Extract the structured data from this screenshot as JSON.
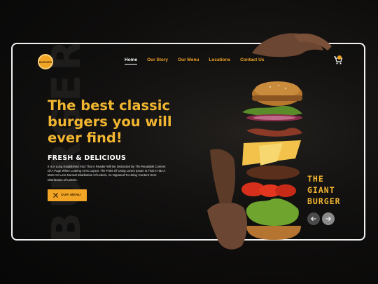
{
  "brand": {
    "logo_text": "BURGER",
    "background_word": "BURGER"
  },
  "nav": {
    "items": [
      {
        "label": "Home",
        "active": true
      },
      {
        "label": "Our Story",
        "active": false
      },
      {
        "label": "Our Menu",
        "active": false
      },
      {
        "label": "Locations",
        "active": false
      },
      {
        "label": "Contact Us",
        "active": false
      }
    ],
    "cart_icon": "shopping-cart-icon"
  },
  "hero": {
    "headline": "The best classic burgers you will ever find!",
    "subheadline": "FRESH & DELICIOUS",
    "paragraph": "It Is A Long Established Fact That A Reader Will Be Distracted By The Readable Content Of A Page When Looking At Its Layout. The Point Of Using Lorem Ipsum Is That It Has A More-Or-Less Normal Distribution Of Letters, As Opposed To Using 'Content Here Distribution Of Letters.",
    "cta_label": "OUR MENU",
    "cta_icon": "fork-knife-icon"
  },
  "feature": {
    "title_line1": "THE",
    "title_line2": "GIANT",
    "title_line3": "BURGER",
    "prev_icon": "arrow-left-icon",
    "next_icon": "arrow-right-icon"
  },
  "colors": {
    "accent": "#f2a524",
    "headline": "#f2b630",
    "background": "#0e0d0c",
    "frame_border": "#f2f2f2"
  }
}
